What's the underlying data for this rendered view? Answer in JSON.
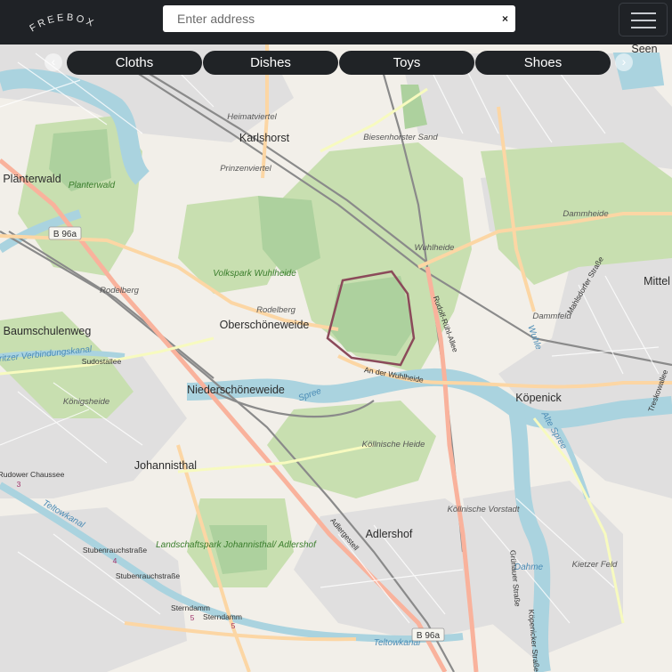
{
  "app": {
    "logo_text": "FREEBOX"
  },
  "search": {
    "placeholder": "Enter address",
    "value": "",
    "clear_label": "×"
  },
  "categories": [
    "Cloths",
    "Dishes",
    "Toys",
    "Shoes"
  ],
  "nav": {
    "prev_label": "‹",
    "next_label": "›"
  },
  "map_labels": {
    "places": [
      "Karlshorst",
      "Plänterwald",
      "Baumschulenweg",
      "Oberschöneweide",
      "Niederschöneweide",
      "Johannisthal",
      "Adlershof",
      "Köpenick",
      "Seen",
      "Mittel"
    ],
    "localities": [
      "Heimatviertel",
      "Prinzenviertel",
      "Biesenhorster Sand",
      "Wuhlheide",
      "Dammheide",
      "Dammfeld",
      "Rodelberg",
      "Königsheide",
      "Köllnische Heide",
      "Köllnische Vorstadt",
      "Kietzer Feld"
    ],
    "parks": [
      "Planterwald",
      "Volkspark Wuhlheide",
      "Landschaftspark Johannisthal/ Adlershof"
    ],
    "water": [
      "Spree",
      "Teltowkanal",
      "Dahme",
      "Alte Spree",
      "Wuhle",
      "Britzer Verbindungskanal"
    ],
    "streets": [
      "Sudostallee",
      "An der Wuhlheide",
      "Rudolf-Rühl-Allee",
      "Adlergestell",
      "Grünauer Straße",
      "Köpenicker Straße",
      "Mahlsdorfer Straße",
      "Stubenrauchstraße",
      "Sterndamm",
      "Rudower Chaussee",
      "Treskowallee"
    ],
    "road_shields": [
      "B 96a",
      "B 96a"
    ],
    "route_numbers": [
      "3",
      "4",
      "5"
    ]
  },
  "colors": {
    "topbar": "#1f2226",
    "pill": "#202326",
    "map_bg": "#f2efe9",
    "park": "#add19e",
    "forest": "#c8dfb0",
    "water": "#aad3df",
    "residential": "#e0dfdf"
  }
}
